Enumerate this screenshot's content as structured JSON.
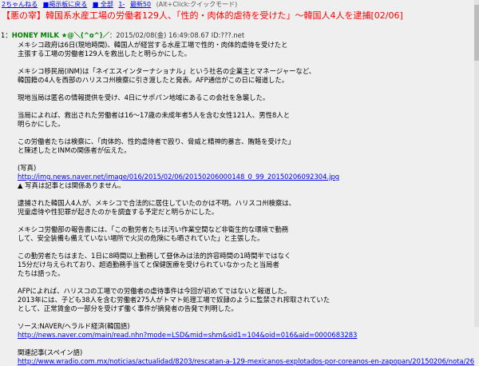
{
  "nav": {
    "site": "2ちゃんねる",
    "board": "■掲示板に戻る",
    "all": "■ 全部",
    "first": "1-",
    "latest": "最新50",
    "hint": "(Alt+Click:クイックモード)"
  },
  "thread_title": "【悪の宰】韓国系水産工場の労働者129人、「性的・肉体的虐待を受けた」～韓国人4人を逮捕[02/06]",
  "post": {
    "num": "1",
    "name": "：HONEY MILK ★@＼(^o^)／",
    "meta": "：2015/02/08(金) 16:49:08.67 ID:???.net",
    "lines": [
      "メキシコ政府は6日(現地時間)、韓国人が経営する水産工場で性的・肉体的虐待を受けたと",
      "主張する工場の労働者129人を救出したと明らかにした。",
      "",
      "メキシコ移民局(INM)は「ネイエスインターナショナル」という社名の企業主とマネージャーなど、",
      "韓国籍の4人を西部のハリスコ州検察に引き渡したと発表。AFP通信がこの日に報道した。",
      "",
      "現地当局は匿名の情報提供を受け、4日にサポパン地域にあるこの会社を急襲した。",
      "",
      "当局によれば、救出された労働者は16～17歳の未成年者5人を含む女性121人、男性8人と",
      "明らかにした。",
      "",
      "この労働者たちは検察に、「肉体的、性的虐待者で殴り、脅威と精神的暴言、賄賂を受けた」",
      "と陳述したとINMの関係者が伝えた。",
      "",
      "(写真)"
    ],
    "photo_link": "http://img.news.naver.net/image/016/2015/02/06/20150206000148_0_99_20150206092304.jpg",
    "lines2": [
      "▲ 写真は記事とは関係ありません。",
      "",
      "逮捕された韓国人4人が、メキシコで合法的に居住していたのかは不明。ハリスコ州検察は、",
      "児童虐待や性犯罪が起きたのかを調査する予定だと明らかにした。",
      "",
      "メキシコ労働部の報告書には、「この勤労者たちは汚い作業空間など非衛生的な環境で勤務",
      "して、安全装備も備えていない場所で火災の危険にも晒されていた」と主張した。",
      "",
      "この勤労者たちはまた、1日に8時間以上勤務して昼休みは法的許容時間の1時間半ではなく",
      "15分だけ与えられており、超過勤務手当てと保健医療を受けられていなかったと当局者",
      "たちは語った。",
      "",
      "AFPによれば、ハリスコの工場での労働者の虐待事件は今回が初めてではないと報道した。",
      "2013年には、子ども38人を含む労働者275人がトマト処理工場で奴隷のように監禁され搾取されていた",
      "として、正常賃金の一部分を受けず働く事件が摘発者の告発で判明した。",
      "",
      "ソース:NAVER/ヘラルド経済(韓国語)"
    ],
    "source_link": "http://news.naver.com/main/read.nhn?mode=LSD&mid=shm&sid1=104&oid=016&aid=0000683283",
    "lines3": [
      "",
      "関連記事(スペイン語)"
    ],
    "related_link": "http://www.wradio.com.mx/noticias/actualidad/8203/rescatan-a-129-mexicanos-explotados-por-coreanos-en-zapopan/20150206/nota/2620689.aspx"
  }
}
